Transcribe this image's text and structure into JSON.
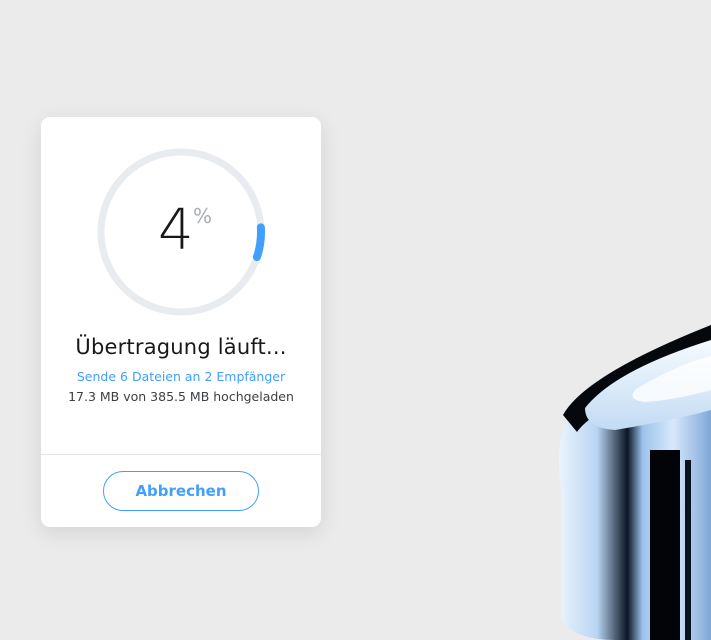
{
  "transfer": {
    "progress_percent": 4,
    "percent_number": "4",
    "percent_sign": "%",
    "status_title": "Übertragung läuft...",
    "recipients_line": "Sende 6 Dateien an 2 Empfänger",
    "size_line": "17.3 MB von 385.5 MB hochgeladen",
    "cancel_label": "Abbrechen"
  },
  "colors": {
    "accent": "#409fff",
    "ring_track": "#e8ebef",
    "background": "#ebebeb",
    "card": "#ffffff"
  },
  "icons": {
    "progress_ring": "progress-ring-icon",
    "decoration": "metallic-object-illustration"
  }
}
